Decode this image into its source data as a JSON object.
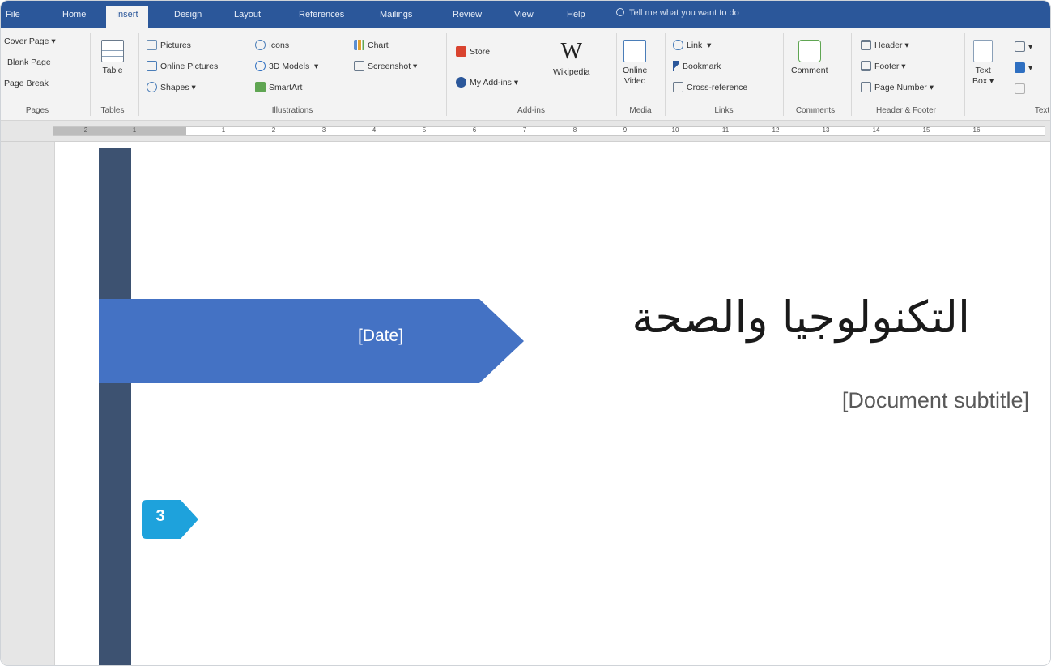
{
  "tabs": [
    "File",
    "Home",
    "Insert",
    "Design",
    "Layout",
    "References",
    "Mailings",
    "Review",
    "View",
    "Help"
  ],
  "tell_me": "Tell me what you want to do",
  "ribbon": {
    "pages": {
      "label": "Pages",
      "cover_page": "Cover Page",
      "blank_page": "Blank Page",
      "page_break": "Page Break"
    },
    "tables": {
      "label": "Tables",
      "table": "Table"
    },
    "illustrations": {
      "label": "Illustrations",
      "pictures": "Pictures",
      "online_pictures": "Online Pictures",
      "shapes": "Shapes",
      "icons": "Icons",
      "models": "3D Models",
      "smartart": "SmartArt",
      "chart": "Chart",
      "screenshot": "Screenshot"
    },
    "addins": {
      "label": "Add-ins",
      "store": "Store",
      "my_addins": "My Add-ins",
      "wikipedia": "Wikipedia",
      "wiki_glyph": "W"
    },
    "media": {
      "label": "Media",
      "online_video_1": "Online",
      "online_video_2": "Video"
    },
    "links": {
      "label": "Links",
      "link": "Link",
      "bookmark": "Bookmark",
      "cross_reference": "Cross-reference"
    },
    "comments": {
      "label": "Comments",
      "comment": "Comment"
    },
    "header_footer": {
      "label": "Header & Footer",
      "header": "Header",
      "footer": "Footer",
      "page_number": "Page Number"
    },
    "text": {
      "label": "Text",
      "text_box_1": "Text",
      "text_box_2": "Box"
    }
  },
  "ruler_numbers": [
    "2",
    "1",
    "1",
    "2",
    "3",
    "4",
    "5",
    "6",
    "7",
    "8",
    "9",
    "10",
    "11",
    "12",
    "13",
    "14",
    "15",
    "16"
  ],
  "document": {
    "date": "[Date]",
    "title": "التكنولوجيا والصحة",
    "subtitle": "[Document subtitle]"
  },
  "callout": "3",
  "colors": {
    "ribbon_blue": "#2b579a",
    "sidebar_bar": "#3d5271",
    "banner_blue": "#4472c4",
    "callout": "#1ea2dc"
  }
}
